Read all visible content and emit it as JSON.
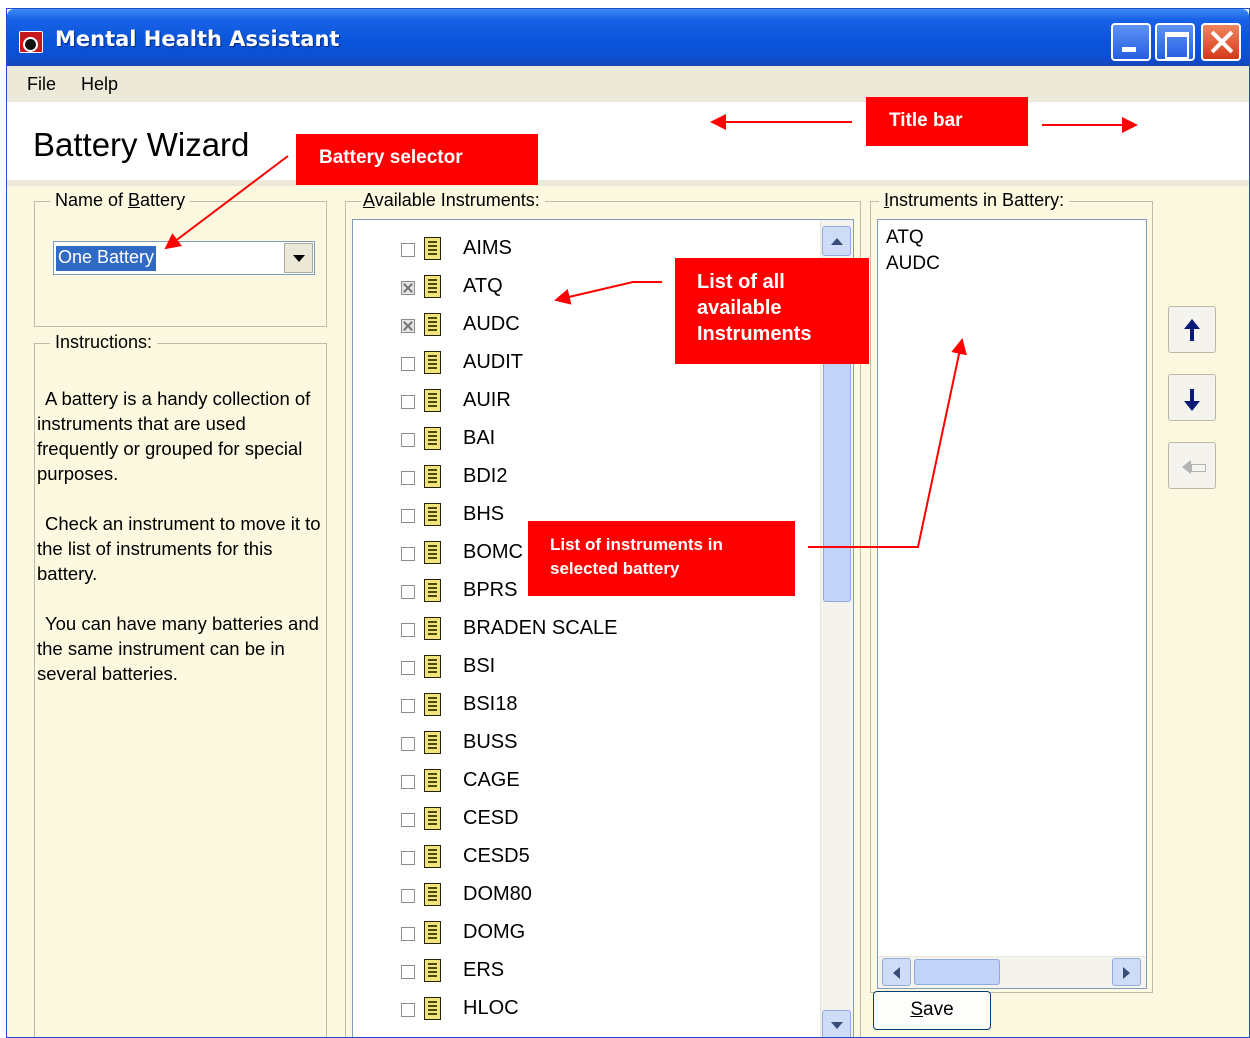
{
  "window": {
    "title": "Mental Health Assistant"
  },
  "menu": {
    "items": [
      "File",
      "Help"
    ]
  },
  "header": {
    "title": "Battery Wizard"
  },
  "battery_group": {
    "label_prefix": "Name of ",
    "label_mnemonic": "B",
    "label_suffix": "attery",
    "selected": "One Battery"
  },
  "instructions": {
    "label": "Instructions:",
    "paragraphs": [
      "A battery is a handy collection of instruments that are used frequently or grouped for special purposes.",
      "Check an instrument to move it to the list of instruments for this battery.",
      "You can have many batteries and the same instrument can be in several batteries."
    ]
  },
  "available": {
    "label_mnemonic": "A",
    "label_suffix": "vailable Instruments:",
    "items": [
      {
        "name": "AIMS",
        "checked": false
      },
      {
        "name": "ATQ",
        "checked": true
      },
      {
        "name": "AUDC",
        "checked": true
      },
      {
        "name": "AUDIT",
        "checked": false
      },
      {
        "name": "AUIR",
        "checked": false
      },
      {
        "name": "BAI",
        "checked": false
      },
      {
        "name": "BDI2",
        "checked": false
      },
      {
        "name": "BHS",
        "checked": false
      },
      {
        "name": "BOMC",
        "checked": false
      },
      {
        "name": "BPRS",
        "checked": false
      },
      {
        "name": "BRADEN SCALE",
        "checked": false
      },
      {
        "name": "BSI",
        "checked": false
      },
      {
        "name": "BSI18",
        "checked": false
      },
      {
        "name": "BUSS",
        "checked": false
      },
      {
        "name": "CAGE",
        "checked": false
      },
      {
        "name": "CESD",
        "checked": false
      },
      {
        "name": "CESD5",
        "checked": false
      },
      {
        "name": "DOM80",
        "checked": false
      },
      {
        "name": "DOMG",
        "checked": false
      },
      {
        "name": "ERS",
        "checked": false
      },
      {
        "name": "HLOC",
        "checked": false
      }
    ]
  },
  "battery_list": {
    "label_mnemonic": "I",
    "label_suffix": "nstruments in Battery:",
    "items": [
      "ATQ",
      "AUDC"
    ]
  },
  "save_button": {
    "mnemonic": "S",
    "suffix": "ave"
  },
  "annotations": {
    "title_bar": "Title bar",
    "battery_selector": "Battery selector",
    "available_list_lines": [
      "List of all",
      "available",
      "Instruments"
    ],
    "battery_list_lines": [
      "List of instruments in",
      "selected battery"
    ]
  },
  "colors": {
    "annotation": "#ff0000",
    "titlebar": "#0a55dc",
    "panel_bg": "#fcf9e0",
    "selection": "#316ac5"
  },
  "icons": {
    "app": "app-logo-icon",
    "minimize": "minimize-icon",
    "maximize": "maximize-icon",
    "close": "close-icon",
    "instrument": "document-icon",
    "move_up": "arrow-up-icon",
    "move_down": "arrow-down-icon",
    "remove": "arrow-left-icon"
  }
}
